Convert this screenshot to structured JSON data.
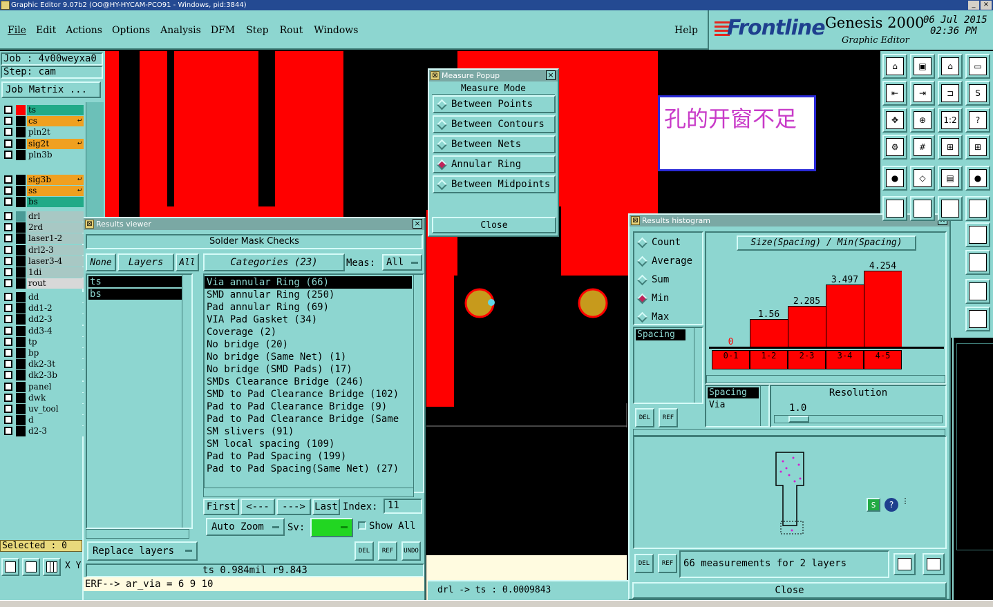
{
  "window_title": "Graphic Editor 9.07b2 (OO@HY-HYCAM-PCO91 - Windows, pid:3844)",
  "window_controls": [
    "_",
    "×"
  ],
  "menu": [
    "File",
    "Edit",
    "Actions",
    "Options",
    "Analysis",
    "DFM",
    "Step",
    "Rout",
    "Windows"
  ],
  "help": "Help",
  "brand": {
    "logo": "Frontline",
    "product": "Genesis 2000",
    "subtitle": "Graphic Editor",
    "date": "06 Jul 2015",
    "time": "02:36 PM"
  },
  "job": {
    "job_label": "Job : 4v00weyxa0",
    "step_label": "Step: cam",
    "matrix_button": "Job Matrix ..."
  },
  "layers": [
    {
      "name": "ts",
      "color": "#ff0000",
      "bg": "#22aa88",
      "flag": ""
    },
    {
      "name": "cs",
      "color": "#000000",
      "bg": "#f0a020",
      "flag": "↵"
    },
    {
      "name": "pln2t",
      "color": "#000000",
      "bg": "#8dd6d0",
      "flag": ""
    },
    {
      "name": "sig2t",
      "color": "#000000",
      "bg": "#f0a020",
      "flag": "↵"
    },
    {
      "name": "pln3b",
      "color": "#000000",
      "bg": "#8dd6d0",
      "flag": ""
    },
    {
      "name": "sig3b",
      "color": "#000000",
      "bg": "#f0a020",
      "flag": "↵"
    },
    {
      "name": "ss",
      "color": "#000000",
      "bg": "#f0a020",
      "flag": "↵"
    },
    {
      "name": "bs",
      "color": "#000000",
      "bg": "#22aa88",
      "flag": ""
    },
    {
      "name": "drl",
      "color": "#4a9a96",
      "bg": "#a8c8c4",
      "flag": ""
    },
    {
      "name": "2rd",
      "color": "#000000",
      "bg": "#a8c8c4",
      "flag": ""
    },
    {
      "name": "laser1-2",
      "color": "#000000",
      "bg": "#a8c8c4",
      "flag": ""
    },
    {
      "name": "drl2-3",
      "color": "#000000",
      "bg": "#a8c8c4",
      "flag": ""
    },
    {
      "name": "laser3-4",
      "color": "#000000",
      "bg": "#a8c8c4",
      "flag": ""
    },
    {
      "name": "1di",
      "color": "#000000",
      "bg": "#a8c8c4",
      "flag": ""
    },
    {
      "name": "rout",
      "color": "#000000",
      "bg": "#d8d8d8",
      "flag": ""
    },
    {
      "name": "dd",
      "color": "#000000",
      "bg": "#8dd6d0",
      "flag": ""
    },
    {
      "name": "dd1-2",
      "color": "#000000",
      "bg": "#8dd6d0",
      "flag": ""
    },
    {
      "name": "dd2-3",
      "color": "#000000",
      "bg": "#8dd6d0",
      "flag": ""
    },
    {
      "name": "dd3-4",
      "color": "#000000",
      "bg": "#8dd6d0",
      "flag": ""
    },
    {
      "name": "tp",
      "color": "#000000",
      "bg": "#8dd6d0",
      "flag": ""
    },
    {
      "name": "bp",
      "color": "#000000",
      "bg": "#8dd6d0",
      "flag": ""
    },
    {
      "name": "dk2-3t",
      "color": "#000000",
      "bg": "#8dd6d0",
      "flag": ""
    },
    {
      "name": "dk2-3b",
      "color": "#000000",
      "bg": "#8dd6d0",
      "flag": ""
    },
    {
      "name": "panel",
      "color": "#000000",
      "bg": "#8dd6d0",
      "flag": ""
    },
    {
      "name": "dwk",
      "color": "#000000",
      "bg": "#8dd6d0",
      "flag": ""
    },
    {
      "name": "uv_tool",
      "color": "#000000",
      "bg": "#8dd6d0",
      "flag": ""
    },
    {
      "name": "d",
      "color": "#000000",
      "bg": "#8dd6d0",
      "flag": ""
    },
    {
      "name": "d2-3",
      "color": "#000000",
      "bg": "#8dd6d0",
      "flag": ""
    }
  ],
  "selected": "Selected : 0",
  "xy_label": "X Y",
  "annotation_text": "孔的开窗不足",
  "measure_popup": {
    "title": "Measure Popup",
    "mode_label": "Measure Mode",
    "modes": [
      "Between Points",
      "Between Contours",
      "Between Nets",
      "Annular Ring",
      "Between Midpoints"
    ],
    "selected_mode": "Annular Ring",
    "close": "Close"
  },
  "results_viewer": {
    "title": "Results viewer",
    "header": "Solder Mask Checks",
    "none_btn": "None",
    "layers_btn": "Layers",
    "all_btn": "All",
    "categories_btn": "Categories (23)",
    "meas_label": "Meas:",
    "meas_value": "All",
    "layer_list": [
      "ts",
      "bs"
    ],
    "categories": [
      "Via annular Ring (66)",
      "SMD annular Ring (250)",
      "Pad annular Ring (69)",
      "VIA Pad Gasket (34)",
      "Coverage (2)",
      "No bridge (20)",
      "No bridge (Same Net) (1)",
      "No bridge (SMD Pads) (17)",
      "SMDs Clearance Bridge (246)",
      "SMD to Pad Clearance Bridge (102)",
      "Pad to Pad Clearance Bridge (9)",
      "Pad to Pad Clearance Bridge (Same",
      "SM slivers (91)",
      "SM local spacing (109)",
      "Pad to Pad Spacing (199)",
      "Pad to Pad Spacing(Same Net) (27)"
    ],
    "first": "First",
    "prev": "<---",
    "next": "--->",
    "last": "Last",
    "index_label": "Index:",
    "index_value": "11",
    "auto_zoom": "Auto Zoom",
    "sv_label": "Sv:",
    "show_all": "Show All",
    "replace_layers": "Replace layers",
    "del": "DEL",
    "ref": "REF",
    "undo": "UNDO",
    "status": "ts 0.984mil  r9.843",
    "erf": "ERF--> ar_via = 6 9 10"
  },
  "measure_status": "drl -> ts : 0.0009843",
  "histogram": {
    "title": "Results histogram",
    "modes": [
      "Count",
      "Average",
      "Sum",
      "Min",
      "Max"
    ],
    "selected_mode": "Min",
    "field_list": [
      "Spacing"
    ],
    "chart_title": "Size(Spacing) / Min(Spacing)",
    "resolution_label": "Resolution",
    "resolution_value": "1.0",
    "type_list": [
      "Spacing",
      "Via"
    ],
    "footer_text": "66 measurements for 2 layers",
    "close": "Close",
    "del": "DEL",
    "ref": "REF"
  },
  "chart_data": {
    "type": "bar",
    "title": "Size(Spacing) / Min(Spacing)",
    "categories": [
      "0-1",
      "1-2",
      "2-3",
      "3-4",
      "4-5"
    ],
    "values": [
      0,
      1.56,
      2.285,
      3.497,
      4.254
    ],
    "labels": [
      "0",
      "1.56",
      "2.285",
      "3.497",
      "4.254"
    ],
    "ylim": [
      0,
      4.254
    ],
    "bar_color": "#ff0000"
  }
}
